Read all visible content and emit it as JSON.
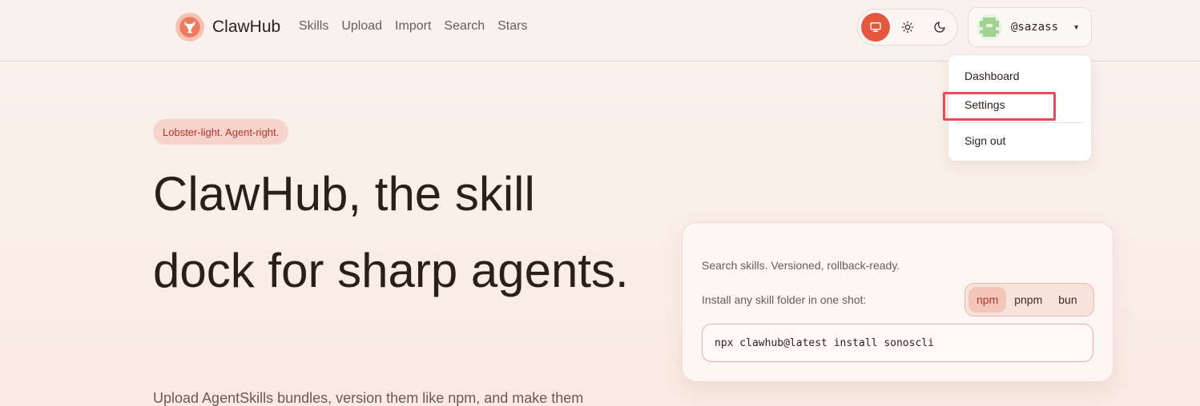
{
  "brand": {
    "name": "ClawHub",
    "logo_icon": "lobster-logo-icon"
  },
  "nav": {
    "items": [
      {
        "label": "Skills"
      },
      {
        "label": "Upload"
      },
      {
        "label": "Import"
      },
      {
        "label": "Search"
      },
      {
        "label": "Stars"
      }
    ]
  },
  "theme": {
    "options": [
      {
        "icon": "monitor-icon",
        "active": true
      },
      {
        "icon": "sun-icon",
        "active": false
      },
      {
        "icon": "moon-icon",
        "active": false
      }
    ],
    "accent_color": "#e3573f"
  },
  "user": {
    "handle": "@sazass",
    "avatar_icon": "pixel-avatar"
  },
  "user_menu": {
    "items": [
      {
        "label": "Dashboard"
      },
      {
        "label": "Settings",
        "highlighted": true
      },
      {
        "label": "Sign out"
      }
    ]
  },
  "hero": {
    "tagline": "Lobster-light. Agent-right.",
    "title": "ClawHub, the skill dock for sharp agents.",
    "subtitle": "Upload AgentSkills bundles, version them like npm, and make them"
  },
  "install_card": {
    "heading": "Search skills. Versioned, rollback-ready.",
    "install_label": "Install any skill folder in one shot:",
    "package_managers": [
      {
        "label": "npm",
        "active": true
      },
      {
        "label": "pnpm",
        "active": false
      },
      {
        "label": "bun",
        "active": false
      }
    ],
    "command": "npx clawhub@latest install sonoscli"
  }
}
